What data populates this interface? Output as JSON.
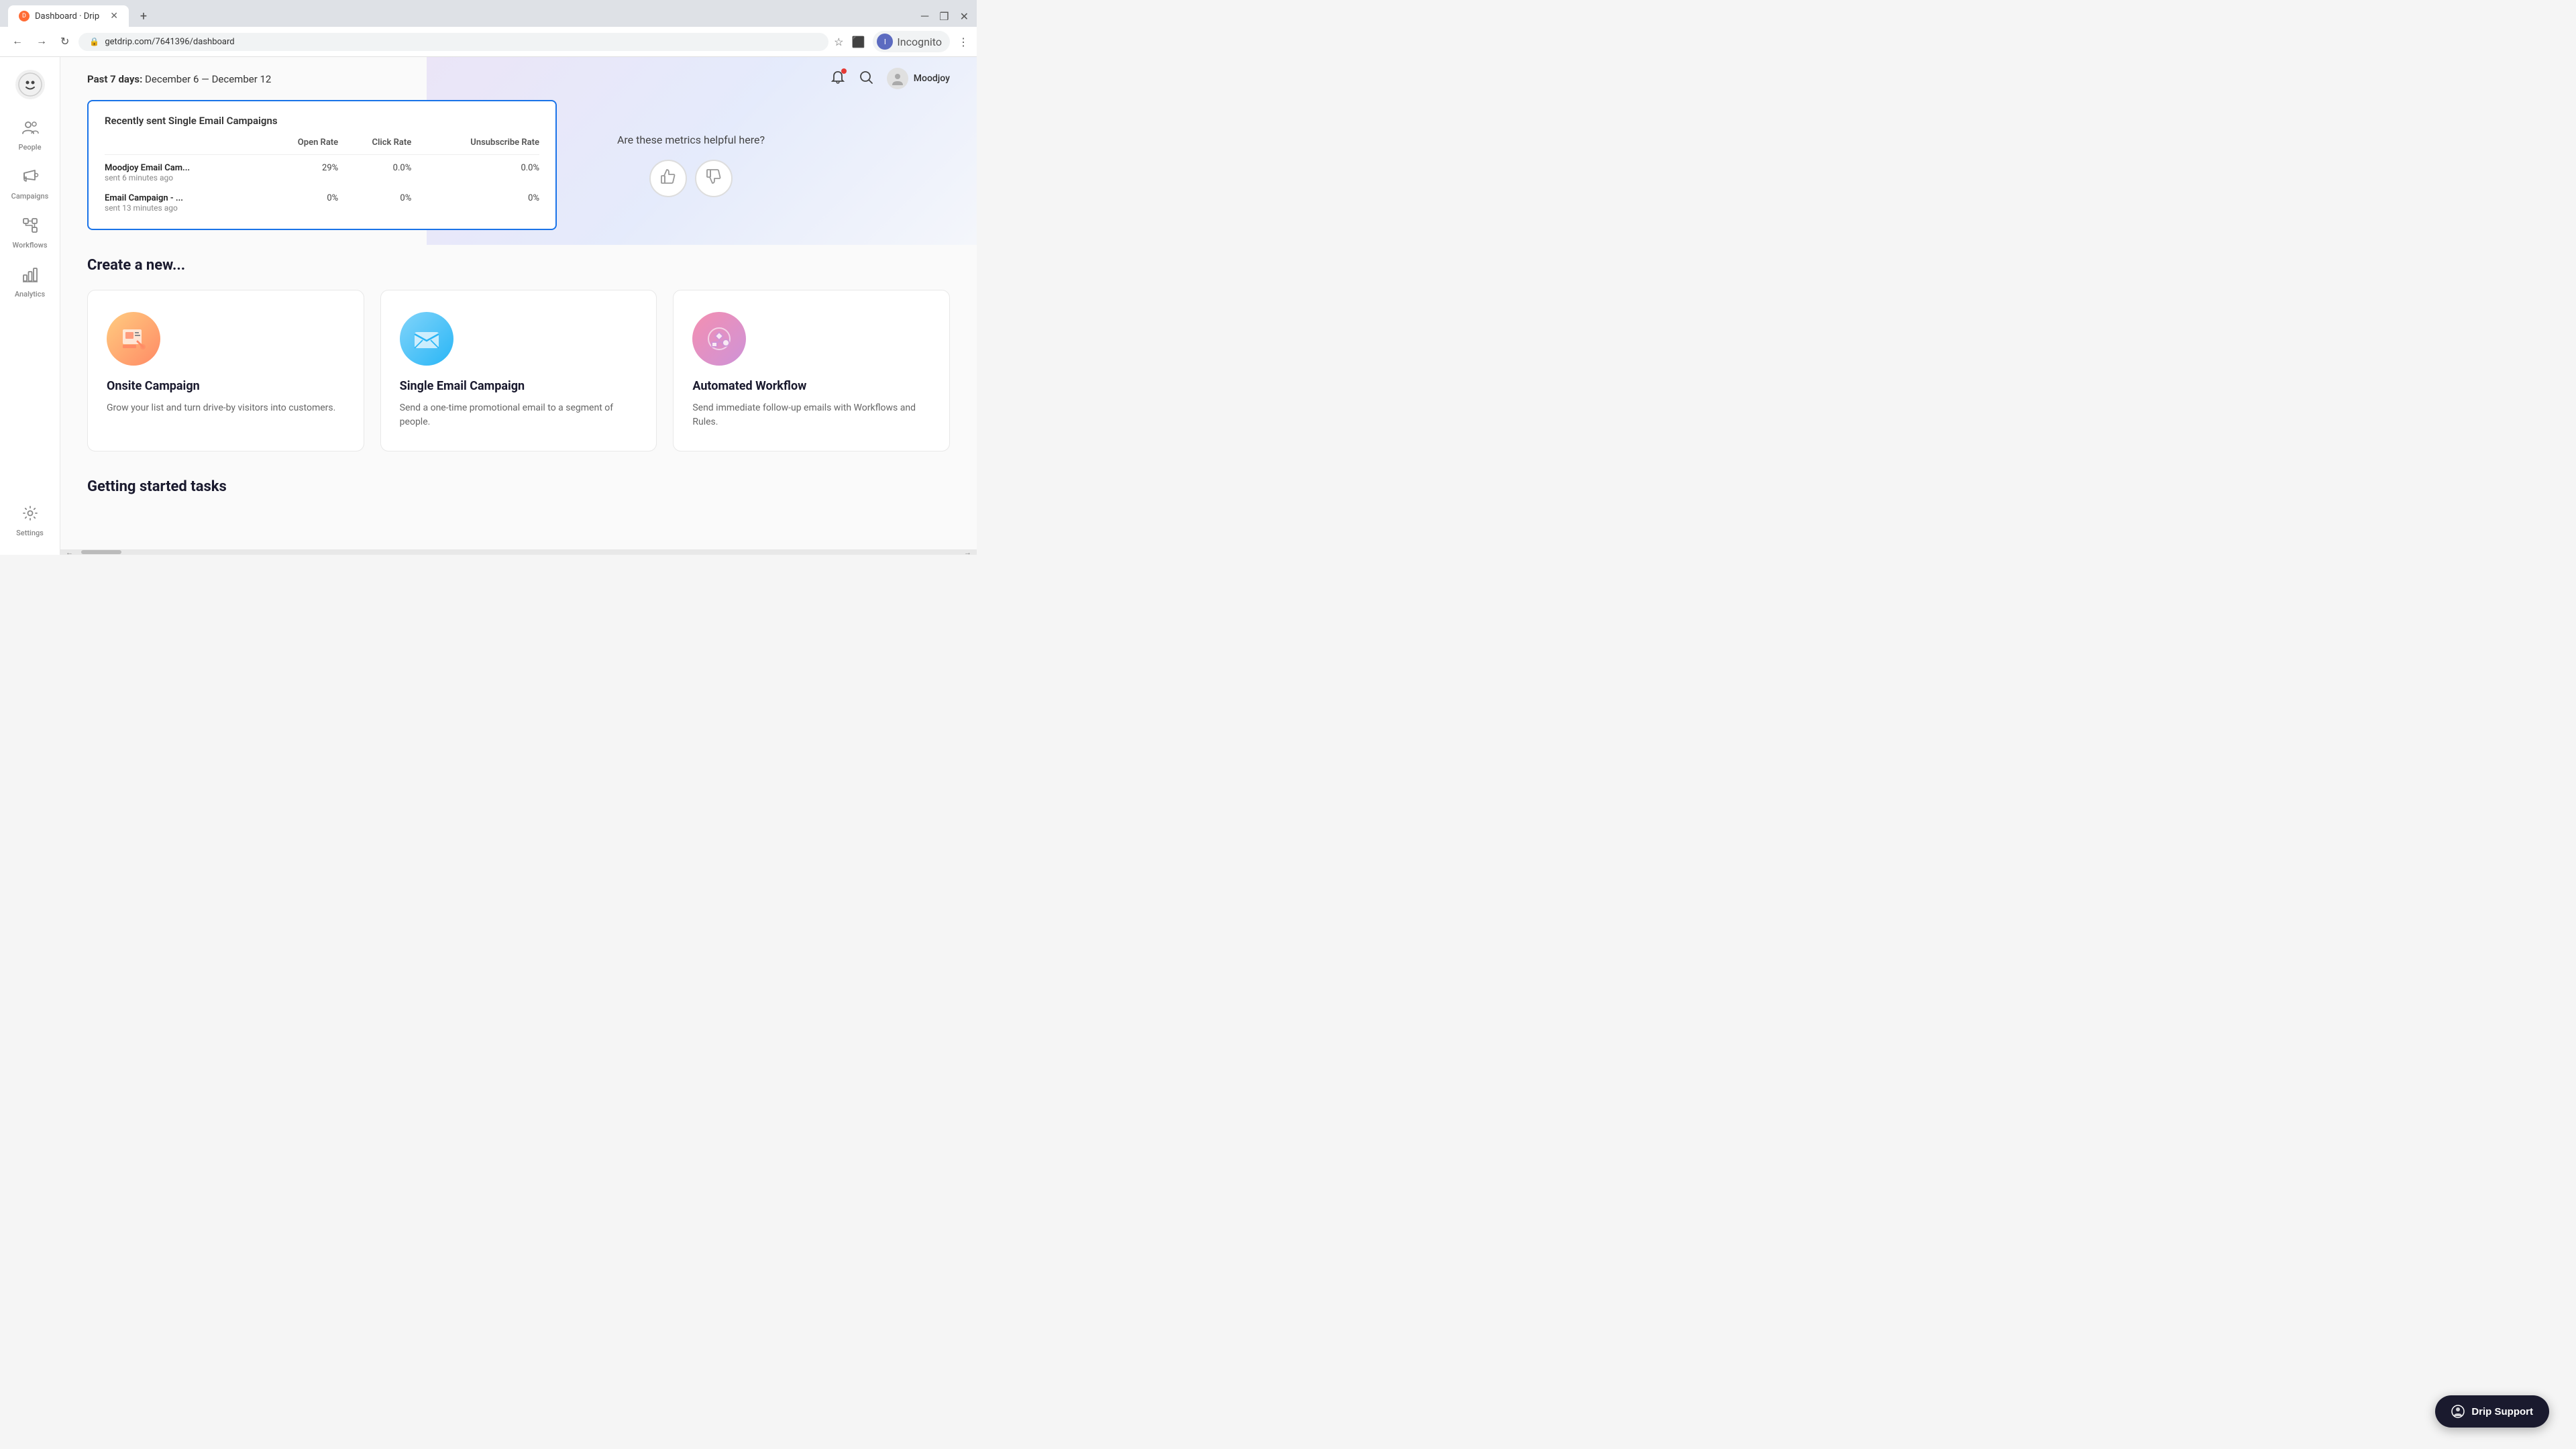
{
  "browser": {
    "tab_title": "Dashboard · Drip",
    "tab_new_label": "+",
    "address": "getdrip.com/7641396/dashboard",
    "window_controls": [
      "▾",
      "─",
      "❐",
      "✕"
    ],
    "profile_name": "Incognito"
  },
  "header": {
    "date_label": "Past 7 days:",
    "date_range": "December 6 — December 12",
    "user_name": "Moodjoy"
  },
  "campaigns_table": {
    "title": "Recently sent Single Email Campaigns",
    "columns": [
      "",
      "Open Rate",
      "Click Rate",
      "Unsubscribe Rate"
    ],
    "rows": [
      {
        "name": "Moodjoy Email Cam...",
        "sent_text": "sent 6 minutes ago",
        "open_rate": "29%",
        "click_rate": "0.0%",
        "unsubscribe_rate": "0.0%"
      },
      {
        "name": "Email Campaign - ...",
        "sent_text": "sent 13 minutes ago",
        "open_rate": "0%",
        "click_rate": "0%",
        "unsubscribe_rate": "0%"
      }
    ]
  },
  "metrics_feedback": {
    "question": "Are these metrics helpful here?",
    "thumbs_up": "👍",
    "thumbs_down": "👎"
  },
  "create_section": {
    "title": "Create a new...",
    "cards": [
      {
        "id": "onsite",
        "title": "Onsite Campaign",
        "description": "Grow your list and turn drive-by visitors into customers.",
        "icon": "📄"
      },
      {
        "id": "email",
        "title": "Single Email Campaign",
        "description": "Send a one-time promotional email to a segment of people.",
        "icon": "✉️"
      },
      {
        "id": "workflow",
        "title": "Automated Workflow",
        "description": "Send immediate follow-up emails with Workflows and Rules.",
        "icon": "🔄"
      }
    ]
  },
  "getting_started": {
    "title": "Getting started tasks"
  },
  "sidebar": {
    "logo_emoji": "☺",
    "items": [
      {
        "id": "people",
        "label": "People",
        "icon": "👥"
      },
      {
        "id": "campaigns",
        "label": "Campaigns",
        "icon": "📢"
      },
      {
        "id": "workflows",
        "label": "Workflows",
        "icon": "⚡"
      },
      {
        "id": "analytics",
        "label": "Analytics",
        "icon": "📊"
      },
      {
        "id": "settings",
        "label": "Settings",
        "icon": "⚙️"
      }
    ]
  },
  "drip_support": {
    "label": "Drip Support"
  }
}
